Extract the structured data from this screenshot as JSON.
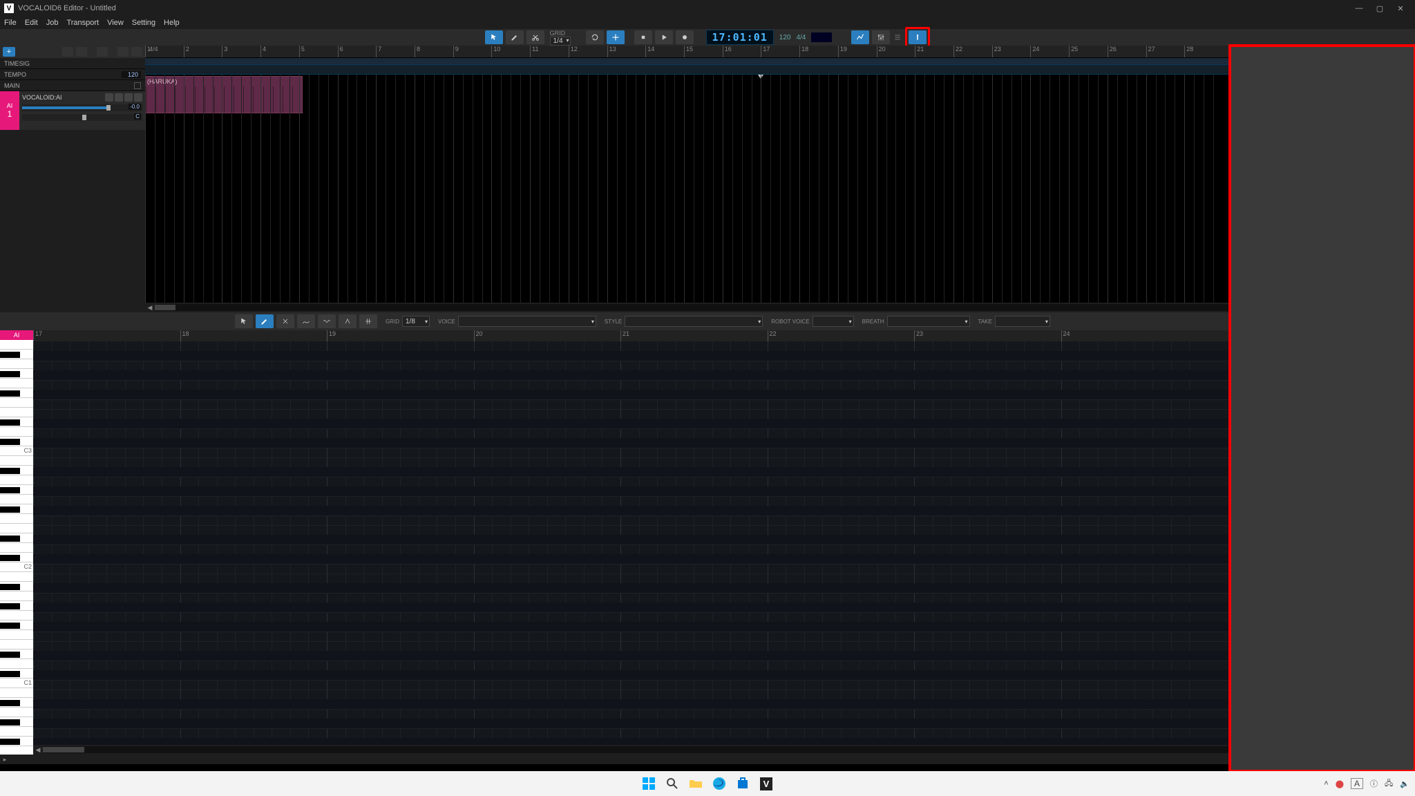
{
  "window": {
    "app_initial": "V",
    "title": "VOCALOID6 Editor - Untitled"
  },
  "menu": [
    "File",
    "Edit",
    "Job",
    "Transport",
    "View",
    "Setting",
    "Help"
  ],
  "toolbar": {
    "grid_label": "GRID",
    "grid_value": "1/4",
    "timecode": "17:01:01",
    "tempo_inline": "120",
    "timesig_inline": "4/4"
  },
  "trackpanel": {
    "timesig_label": "TIMESIG",
    "tempo_label": "TEMPO",
    "tempo_value": "120",
    "main_label": "MAIN",
    "track": {
      "badge": "AI",
      "number": "1",
      "name": "VOCALOID:AI",
      "vol_db": "-0.0",
      "pan": "C"
    }
  },
  "clip": {
    "name": "(HARUKA)"
  },
  "arrange_ruler": {
    "start": 1,
    "end": 28,
    "timesig_marker": "4/4"
  },
  "midbar": {
    "grid_label": "GRID",
    "grid_value": "1/8",
    "voice_label": "VOICE",
    "voice_value": "",
    "style_label": "STYLE",
    "style_value": "",
    "robot_label": "ROBOT VOICE",
    "breath_label": "BREATH",
    "take_label": "TAKE"
  },
  "pianoroll": {
    "badge": "AI",
    "ruler_start": 17,
    "ruler_end": 24,
    "c_labels": [
      "C3",
      "C2",
      "C1"
    ]
  },
  "taskbar": {
    "tray_lang": "A"
  }
}
